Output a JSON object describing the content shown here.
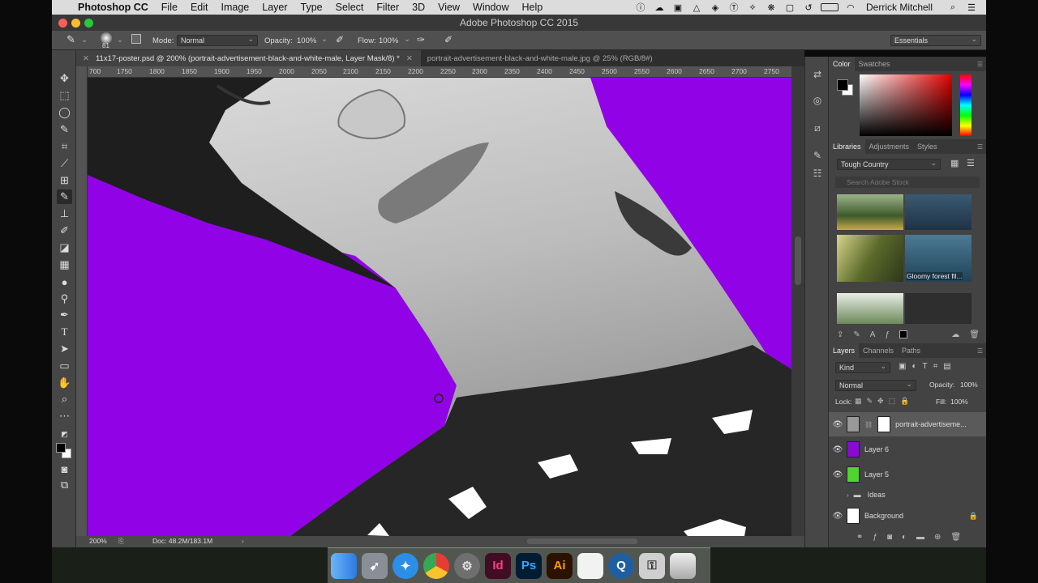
{
  "menubar": {
    "app": "Photoshop CC",
    "items": [
      "File",
      "Edit",
      "Image",
      "Layer",
      "Type",
      "Select",
      "Filter",
      "3D",
      "View",
      "Window",
      "Help"
    ],
    "user": "Derrick Mitchell"
  },
  "window": {
    "title": "Adobe Photoshop CC 2015"
  },
  "options": {
    "brush_size": "81",
    "mode_label": "Mode:",
    "mode_value": "Normal",
    "opacity_label": "Opacity:",
    "opacity_value": "100%",
    "flow_label": "Flow:",
    "flow_value": "100%",
    "workspace": "Essentials"
  },
  "tabs": [
    {
      "label": "11x17-poster.psd @ 200% (portrait-advertisement-black-and-white-male, Layer Mask/8) *",
      "active": true
    },
    {
      "label": "portrait-advertisement-black-and-white-male.jpg @ 25% (RGB/8#)",
      "active": false
    }
  ],
  "ruler": [
    "700",
    "1750",
    "1800",
    "1850",
    "1900",
    "1950",
    "2000",
    "2050",
    "2100",
    "2150",
    "2200",
    "2250",
    "2300",
    "2350",
    "2400",
    "2450",
    "2500",
    "2550",
    "2600",
    "2650",
    "2700",
    "2750"
  ],
  "status": {
    "zoom": "200%",
    "doc": "Doc: 48.2M/183.1M"
  },
  "color_panel": {
    "tabs": [
      "Color",
      "Swatches"
    ],
    "foreground": "#000000",
    "background": "#ffffff"
  },
  "libraries": {
    "tabs": [
      "Libraries",
      "Adjustments",
      "Styles"
    ],
    "library": "Tough Country",
    "search_placeholder": "Search Adobe Stock",
    "items": [
      {
        "caption": ""
      },
      {
        "caption": ""
      },
      {
        "caption": ""
      },
      {
        "caption": "Gloomy forest fil..."
      },
      {
        "caption": ""
      },
      {
        "caption": ""
      }
    ]
  },
  "layers_panel": {
    "tabs": [
      "Layers",
      "Channels",
      "Paths"
    ],
    "kind": "Kind",
    "blend": "Normal",
    "opacity_label": "Opacity:",
    "opacity": "100%",
    "lock_label": "Lock:",
    "fill_label": "Fill:",
    "fill": "100%",
    "layers": [
      {
        "name": "portrait-advertiseme...",
        "visible": true,
        "selected": true,
        "color": "#888888"
      },
      {
        "name": "Layer 6",
        "visible": true,
        "selected": false,
        "color": "#8a0ad4"
      },
      {
        "name": "Layer 5",
        "visible": true,
        "selected": false,
        "color": "#4fd430"
      },
      {
        "name": "Ideas",
        "visible": false,
        "selected": false,
        "color": ""
      },
      {
        "name": "Background",
        "visible": true,
        "selected": false,
        "color": "#ffffff"
      }
    ]
  },
  "colors": {
    "purple": "#9103e6",
    "accent": "#2a86d8"
  },
  "dock": [
    {
      "label": "",
      "icon": "finder-icon"
    },
    {
      "label": "",
      "icon": "rocket-icon"
    },
    {
      "label": "",
      "icon": "safari-icon"
    },
    {
      "label": "",
      "icon": "chrome-icon"
    },
    {
      "label": "",
      "icon": "gear-icon"
    },
    {
      "label": "Id",
      "icon": "indesign-icon"
    },
    {
      "label": "Ps",
      "icon": "photoshop-icon"
    },
    {
      "label": "Ai",
      "icon": "illustrator-icon"
    },
    {
      "label": "",
      "icon": "document-icon"
    },
    {
      "label": "",
      "icon": "quicktime-icon"
    },
    {
      "label": "",
      "icon": "keychain-icon"
    },
    {
      "label": "",
      "icon": "trash-icon"
    }
  ]
}
